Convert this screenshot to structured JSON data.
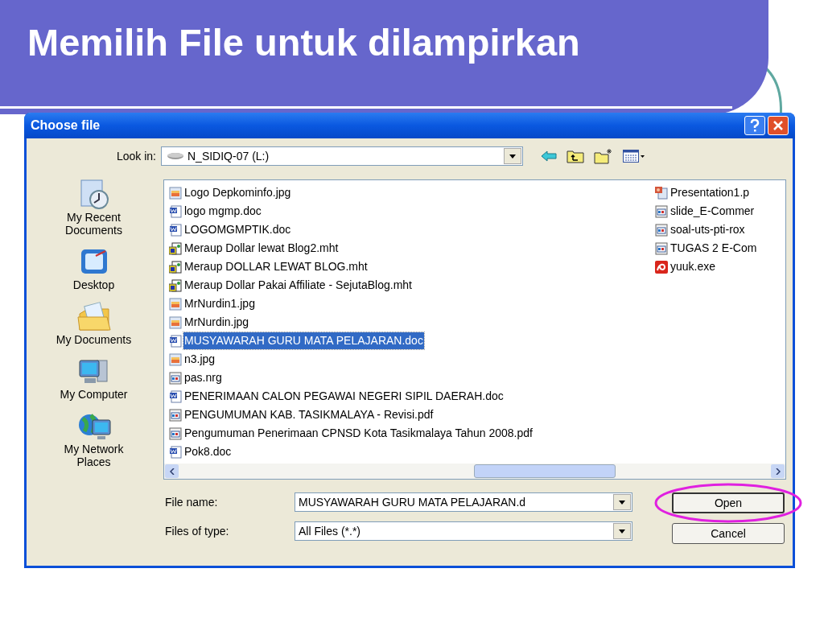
{
  "slide": {
    "title": "Memilih File untuk dilampirkan"
  },
  "window": {
    "title": "Choose file"
  },
  "look_in": {
    "label": "Look in:",
    "value": "N_SIDIQ-07 (L:)"
  },
  "places": [
    {
      "label": "My Recent Documents",
      "kind": "recent"
    },
    {
      "label": "Desktop",
      "kind": "desktop"
    },
    {
      "label": "My Documents",
      "kind": "documents"
    },
    {
      "label": "My Computer",
      "kind": "computer"
    },
    {
      "label": "My Network Places",
      "kind": "network"
    }
  ],
  "file_columns": [
    [
      {
        "name": "Logo Depkominfo.jpg",
        "kind": "image",
        "selected": false
      },
      {
        "name": "logo mgmp.doc",
        "kind": "word",
        "selected": false
      },
      {
        "name": "LOGOMGMPTIK.doc",
        "kind": "word",
        "selected": false
      },
      {
        "name": "Meraup Dollar lewat Blog2.mht",
        "kind": "web",
        "selected": false
      },
      {
        "name": "Meraup DOLLAR LEWAT BLOG.mht",
        "kind": "web",
        "selected": false
      },
      {
        "name": "Meraup Dollar Pakai Affiliate - SejutaBlog.mht",
        "kind": "web",
        "selected": false
      },
      {
        "name": "MrNurdin1.jpg",
        "kind": "image",
        "selected": false
      },
      {
        "name": "MrNurdin.jpg",
        "kind": "image",
        "selected": false
      },
      {
        "name": "MUSYAWARAH GURU MATA PELAJARAN.doc",
        "kind": "word",
        "selected": true
      },
      {
        "name": "n3.jpg",
        "kind": "image",
        "selected": false
      },
      {
        "name": "pas.nrg",
        "kind": "generic",
        "selected": false
      },
      {
        "name": "PENERIMAAN CALON PEGAWAI NEGERI SIPIL DAERAH.doc",
        "kind": "word",
        "selected": false
      },
      {
        "name": "PENGUMUMAN KAB. TASIKMALAYA - Revisi.pdf",
        "kind": "generic",
        "selected": false
      },
      {
        "name": "Pengumuman Penerimaan CPNSD Kota Tasikmalaya Tahun 2008.pdf",
        "kind": "generic",
        "selected": false
      },
      {
        "name": "Pok8.doc",
        "kind": "word",
        "selected": false
      }
    ],
    [
      {
        "name": "Presentation1.p",
        "kind": "presentation",
        "selected": false
      },
      {
        "name": "slide_E-Commer",
        "kind": "generic",
        "selected": false
      },
      {
        "name": "soal-uts-pti-rox",
        "kind": "generic",
        "selected": false
      },
      {
        "name": "TUGAS 2 E-Com",
        "kind": "generic",
        "selected": false
      },
      {
        "name": "yuuk.exe",
        "kind": "app",
        "selected": false
      }
    ]
  ],
  "file_name": {
    "label": "File name:",
    "value": "MUSYAWARAH GURU MATA PELAJARAN.d"
  },
  "file_type": {
    "label": "Files of type:",
    "value": "All Files (*.*)"
  },
  "buttons": [
    {
      "label": "Open",
      "highlighted": true
    },
    {
      "label": "Cancel",
      "highlighted": false
    }
  ]
}
